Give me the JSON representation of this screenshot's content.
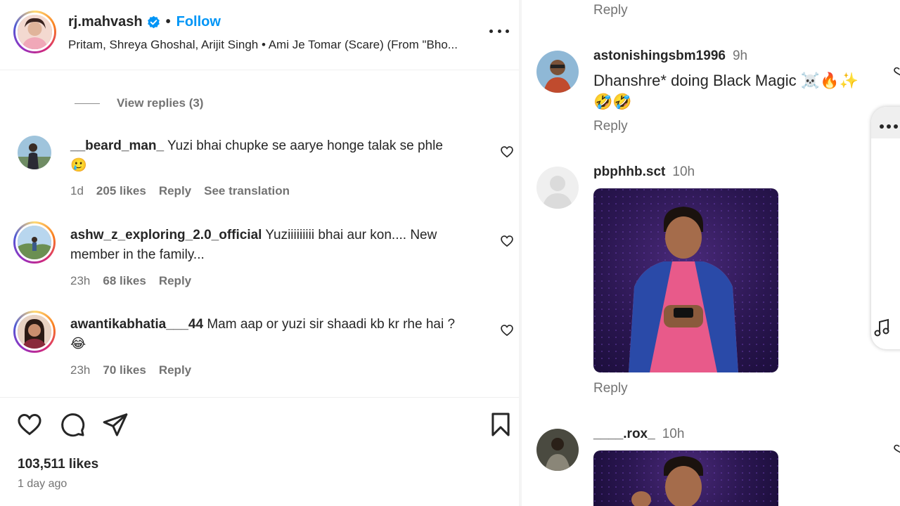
{
  "post_header": {
    "username": "rj.mahvash",
    "separator": "•",
    "follow_label": "Follow",
    "audio": "Pritam, Shreya Ghoshal, Arijit Singh • Ami Je Tomar (Scare) (From \"Bho..."
  },
  "thread": {
    "view_replies": "View replies (3)"
  },
  "comments": [
    {
      "username": "__beard_man_",
      "text": "Yuzi bhai chupke se aarye honge talak se phle",
      "emoji": "🥲",
      "time": "1d",
      "likes": "205 likes",
      "reply": "Reply",
      "translation": "See translation"
    },
    {
      "username": "ashw_z_exploring_2.0_official",
      "text": "Yuziiiiiiiii bhai aur kon.... New member in the family...",
      "time": "23h",
      "likes": "68 likes",
      "reply": "Reply"
    },
    {
      "username": "awantikabhatia___44",
      "text": "Mam aap or yuzi sir shaadi kb kr rhe hai ?",
      "emoji": "😂",
      "time": "23h",
      "likes": "70 likes",
      "reply": "Reply"
    }
  ],
  "post_footer": {
    "likes": "103,511 likes",
    "posted": "1 day ago"
  },
  "right_thread": {
    "top_reply": "Reply",
    "items": [
      {
        "username": "astonishingsbm1996",
        "time": "9h",
        "text": "Dhanshre* doing Black Magic ☠️🔥✨ 🤣🤣",
        "reply": "Reply"
      },
      {
        "username": "pbphhb.sct",
        "time": "10h",
        "reply": "Reply"
      },
      {
        "username": "____.rox_",
        "time": "10h"
      }
    ]
  },
  "colors": {
    "accent": "#0095f6",
    "text": "#262626",
    "muted": "#737373"
  }
}
